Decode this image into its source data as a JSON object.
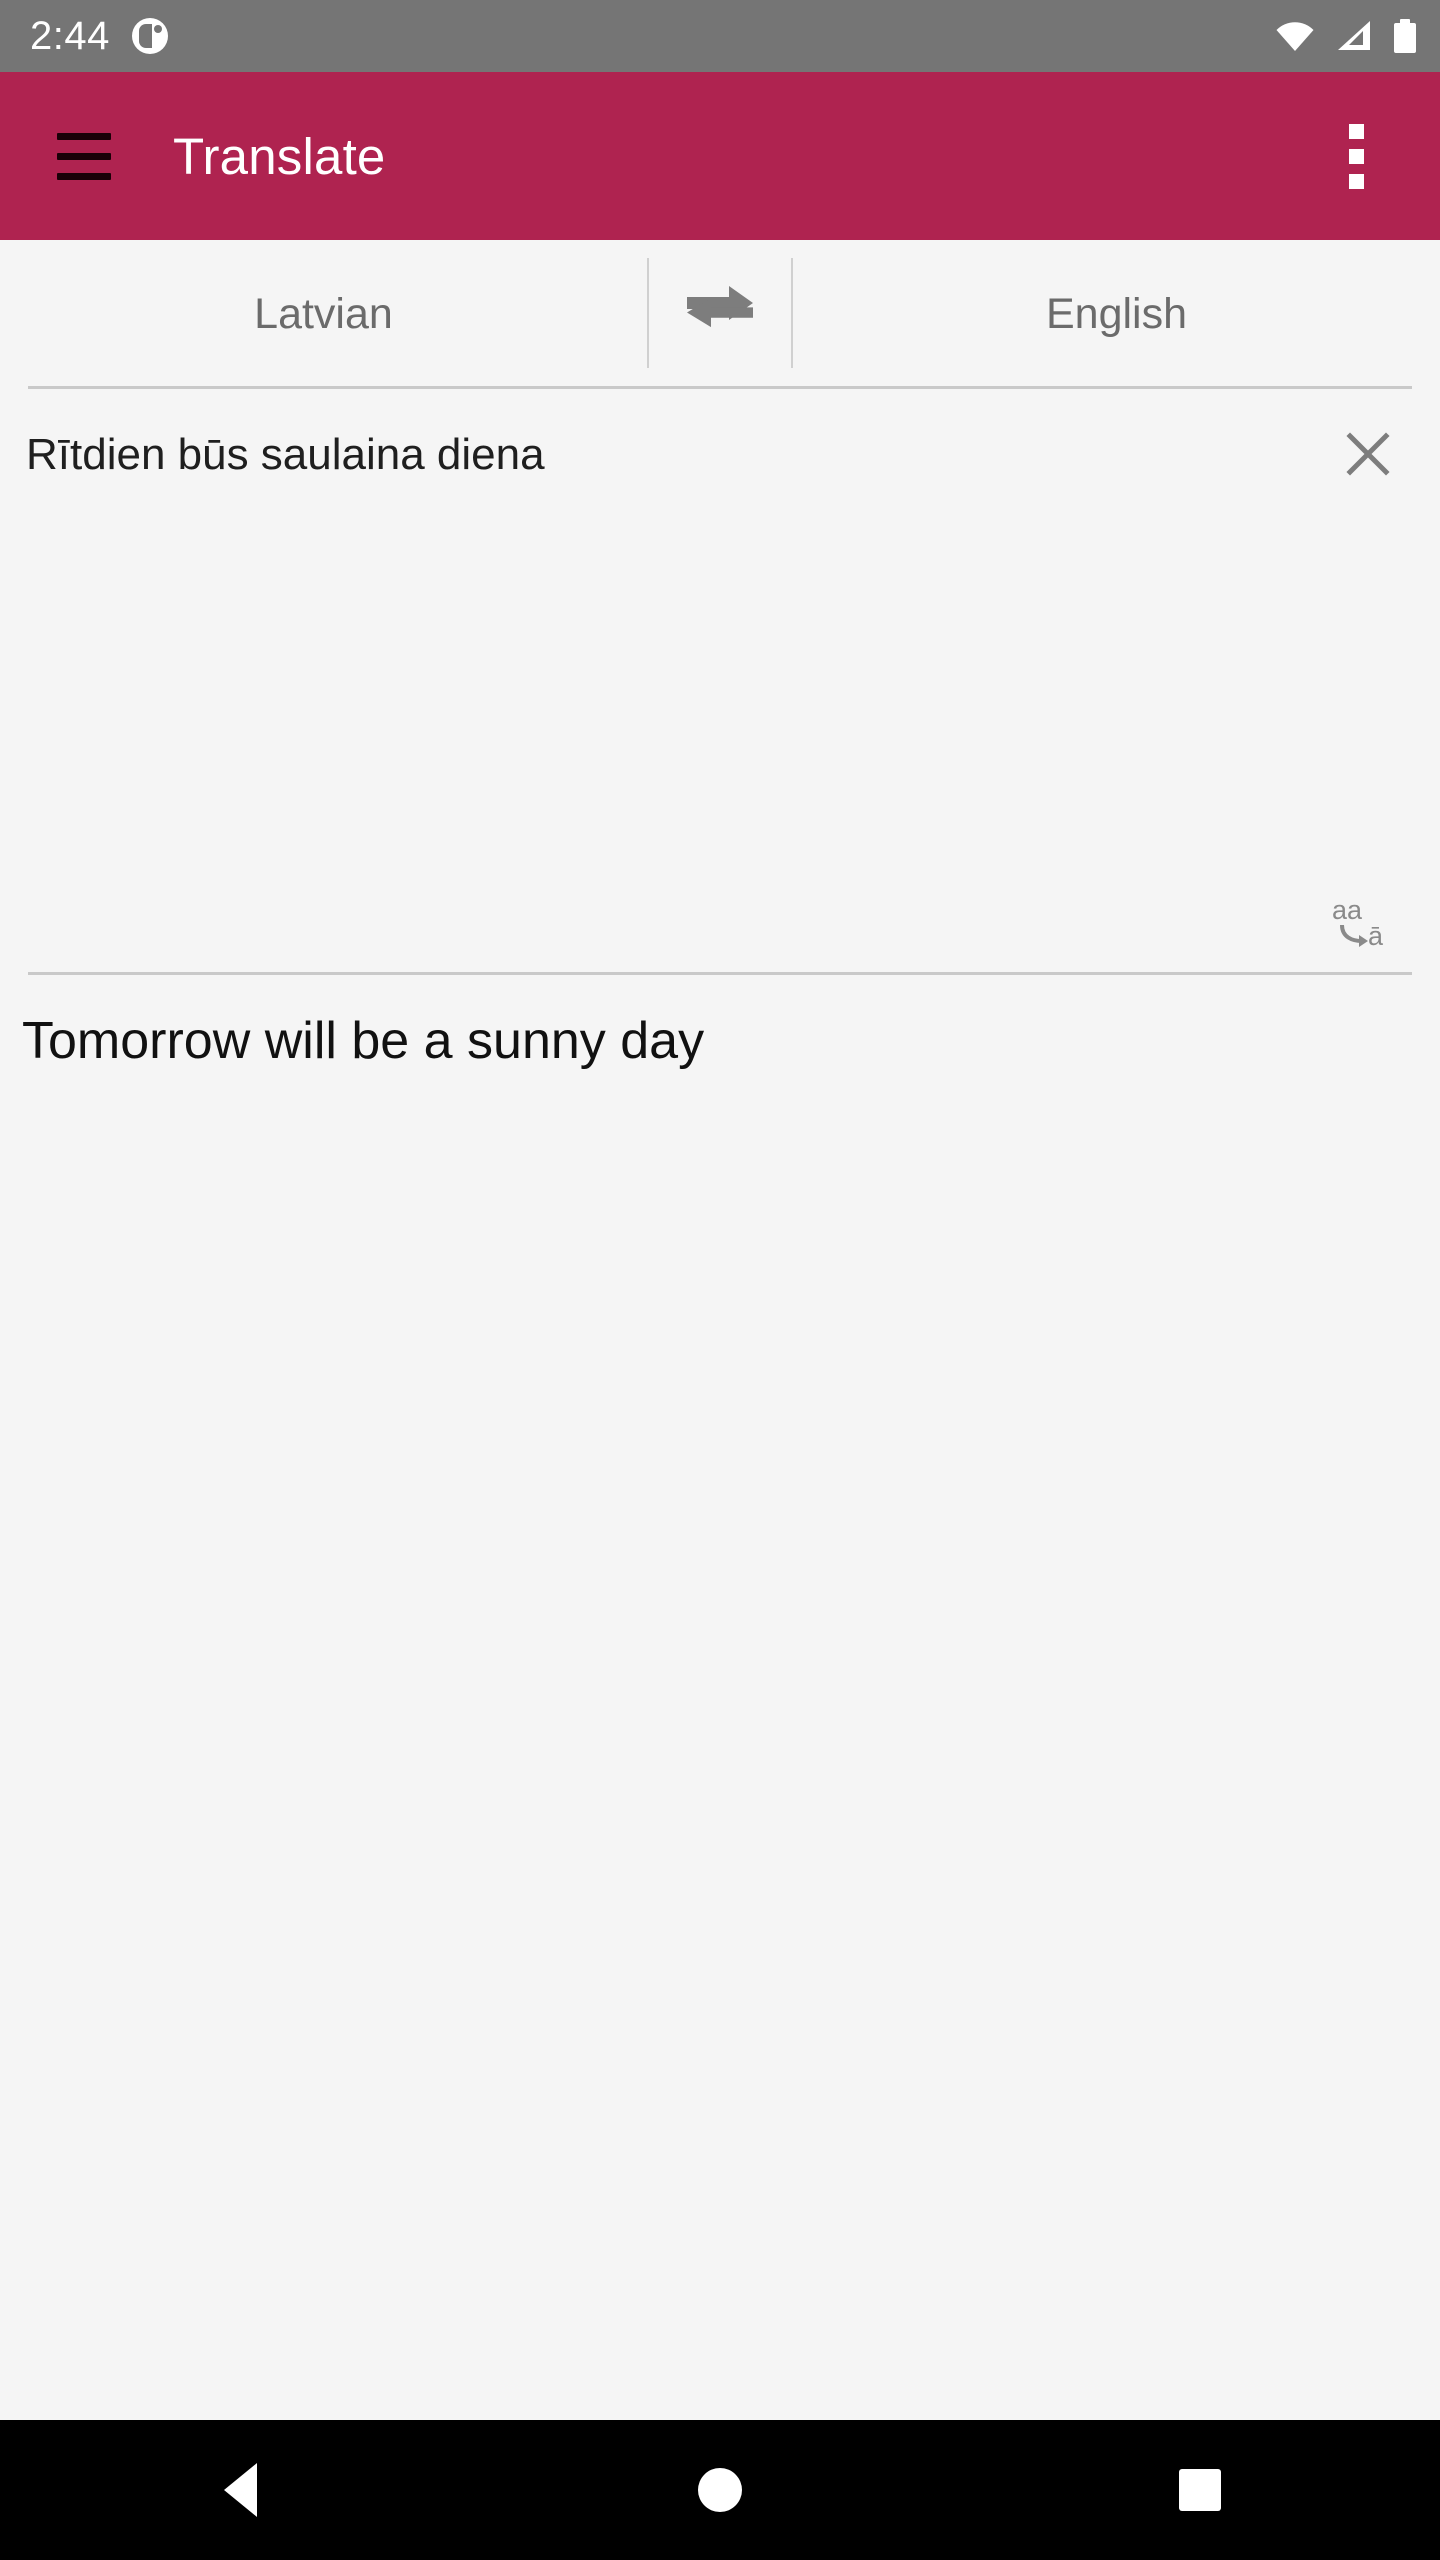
{
  "status_bar": {
    "time": "2:44",
    "notification_icon": "app-notification-icon",
    "wifi_icon": "wifi-full-icon",
    "signal_icon": "cellular-signal-icon",
    "battery_icon": "battery-full-icon",
    "background_color": "#757575"
  },
  "app_bar": {
    "menu_icon": "hamburger-menu-icon",
    "title": "Translate",
    "overflow_icon": "overflow-menu-icon",
    "background_color": "#AF2350",
    "title_color": "#FFFFFF"
  },
  "language_bar": {
    "source_language": "Latvian",
    "target_language": "English",
    "swap_icon": "swap-horizontal-icon",
    "text_color": "#6B6B6B"
  },
  "source_panel": {
    "text": "Rītdien būs saulaina diena",
    "clear_icon": "close-x-icon",
    "transliterate_icon": "transliteration-aa-to-a-macron-icon",
    "transliterate_label_from": "aa",
    "transliterate_label_to": "ā",
    "text_color": "#1F1F1F"
  },
  "target_panel": {
    "text": "Tomorrow will be a sunny day",
    "text_color": "#111111"
  },
  "navigation_bar": {
    "back_icon": "back-triangle-icon",
    "home_icon": "home-circle-icon",
    "recents_icon": "recents-square-icon",
    "background_color": "#000000"
  },
  "page": {
    "background_color": "#F5F5F5"
  }
}
